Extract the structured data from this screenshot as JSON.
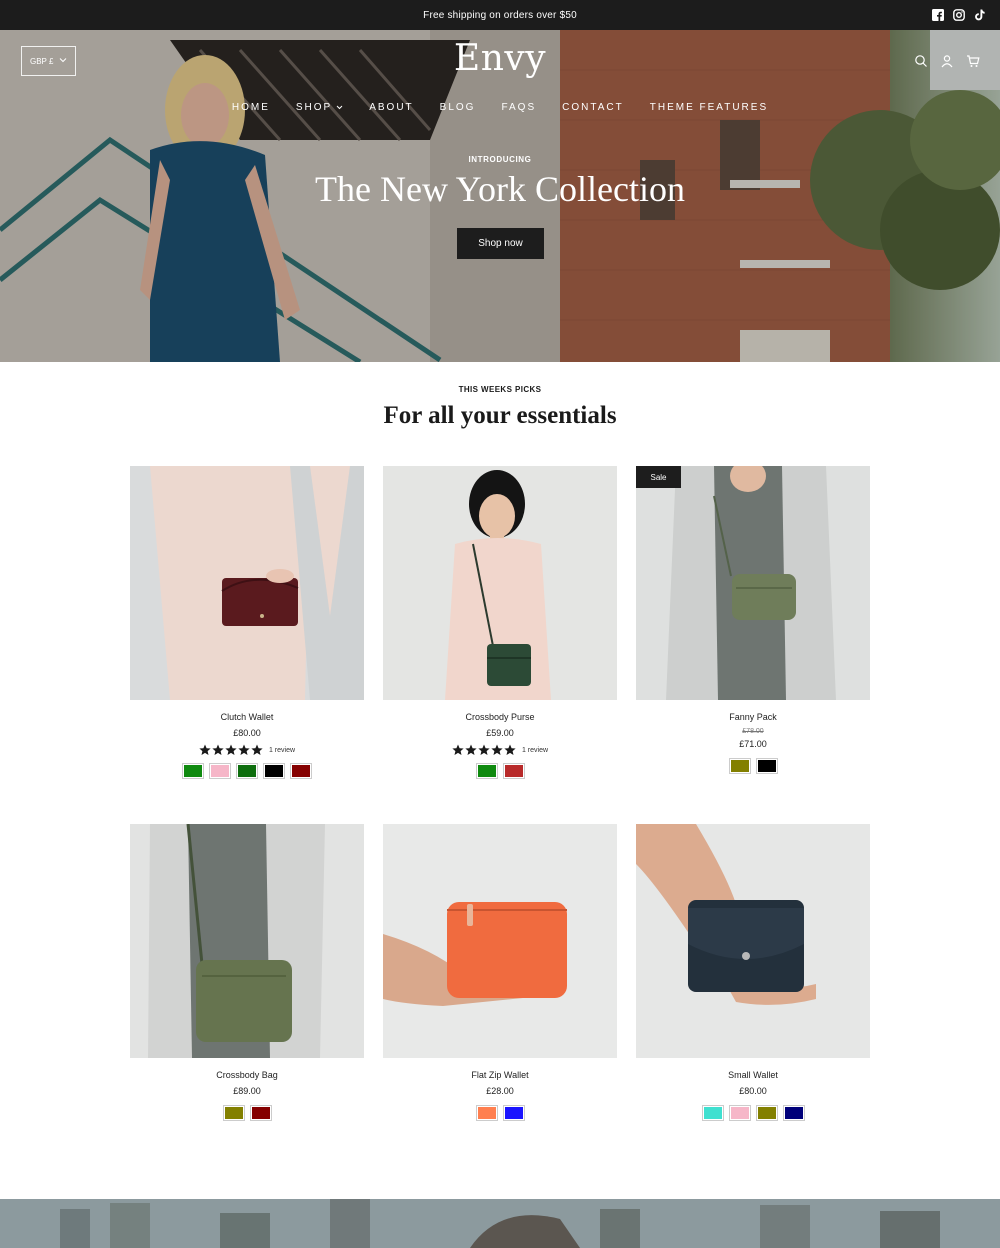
{
  "announcement": {
    "text": "Free shipping on orders over $50"
  },
  "social_icons": [
    "facebook-icon",
    "instagram-icon",
    "tiktok-icon"
  ],
  "header": {
    "currency": "GBP £",
    "logo": "Envy",
    "icons": [
      "search-icon",
      "account-icon",
      "cart-icon"
    ],
    "nav": [
      {
        "label": "HOME"
      },
      {
        "label": "SHOP",
        "dropdown": true
      },
      {
        "label": "ABOUT"
      },
      {
        "label": "BLOG"
      },
      {
        "label": "FAQS"
      },
      {
        "label": "CONTACT"
      },
      {
        "label": "THEME FEATURES"
      }
    ]
  },
  "hero": {
    "kicker": "INTRODUCING",
    "title": "The New York Collection",
    "button": "Shop now"
  },
  "section": {
    "kicker": "THIS WEEKS PICKS",
    "title": "For all your essentials"
  },
  "products": [
    {
      "name": "Clutch Wallet",
      "price": "£80.00",
      "rating": 5,
      "review_text": "1 review",
      "swatches": [
        "#0f8a0f",
        "#f6b6c8",
        "#0e6e0e",
        "#000000",
        "#850000"
      ]
    },
    {
      "name": "Crossbody Purse",
      "price": "£59.00",
      "rating": 5,
      "review_text": "1 review",
      "swatches": [
        "#0f8a0f",
        "#b82a2a"
      ]
    },
    {
      "name": "Fanny Pack",
      "sale_badge": "Sale",
      "compare_price": "£78.00",
      "price": "£71.00",
      "swatches": [
        "#838000",
        "#000000"
      ]
    },
    {
      "name": "Crossbody Bag",
      "price": "£89.00",
      "swatches": [
        "#838000",
        "#850000"
      ]
    },
    {
      "name": "Flat Zip Wallet",
      "price": "£28.00",
      "swatches": [
        "#ff7f4f",
        "#1a14ff"
      ]
    },
    {
      "name": "Small Wallet",
      "price": "£80.00",
      "swatches": [
        "#3fe0d0",
        "#f6b6c8",
        "#838000",
        "#00007a"
      ]
    }
  ]
}
